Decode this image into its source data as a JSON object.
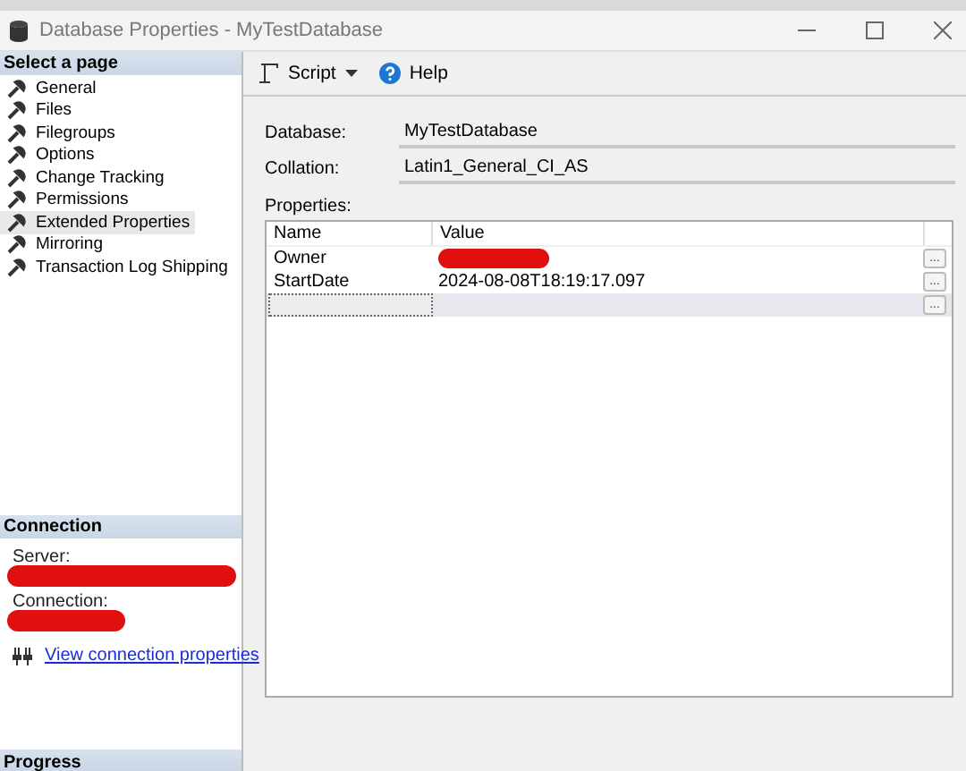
{
  "window": {
    "title": "Database Properties - MyTestDatabase"
  },
  "sidebar": {
    "header": "Select a page",
    "items": [
      {
        "label": "General",
        "selected": false
      },
      {
        "label": "Files",
        "selected": false
      },
      {
        "label": "Filegroups",
        "selected": false
      },
      {
        "label": "Options",
        "selected": false
      },
      {
        "label": "Change Tracking",
        "selected": false
      },
      {
        "label": "Permissions",
        "selected": false
      },
      {
        "label": "Extended Properties",
        "selected": true
      },
      {
        "label": "Mirroring",
        "selected": false
      },
      {
        "label": "Transaction Log Shipping",
        "selected": false
      }
    ]
  },
  "connection": {
    "header": "Connection",
    "server_label": "Server:",
    "connection_label": "Connection:",
    "link": "View connection properties"
  },
  "progress": {
    "header": "Progress"
  },
  "toolbar": {
    "script": "Script",
    "help": "Help"
  },
  "form": {
    "database_label": "Database:",
    "database": "MyTestDatabase",
    "collation_label": "Collation:",
    "collation": "Latin1_General_CI_AS",
    "properties_label": "Properties:"
  },
  "table": {
    "columns": [
      "Name",
      "Value"
    ],
    "rows": [
      {
        "name": "Owner",
        "value": "",
        "redacted": true,
        "selected": false
      },
      {
        "name": "StartDate",
        "value": "2024-08-08T18:19:17.097",
        "redacted": false,
        "selected": false
      },
      {
        "name": "",
        "value": "",
        "redacted": false,
        "selected": true
      }
    ],
    "ellipsis": "..."
  }
}
